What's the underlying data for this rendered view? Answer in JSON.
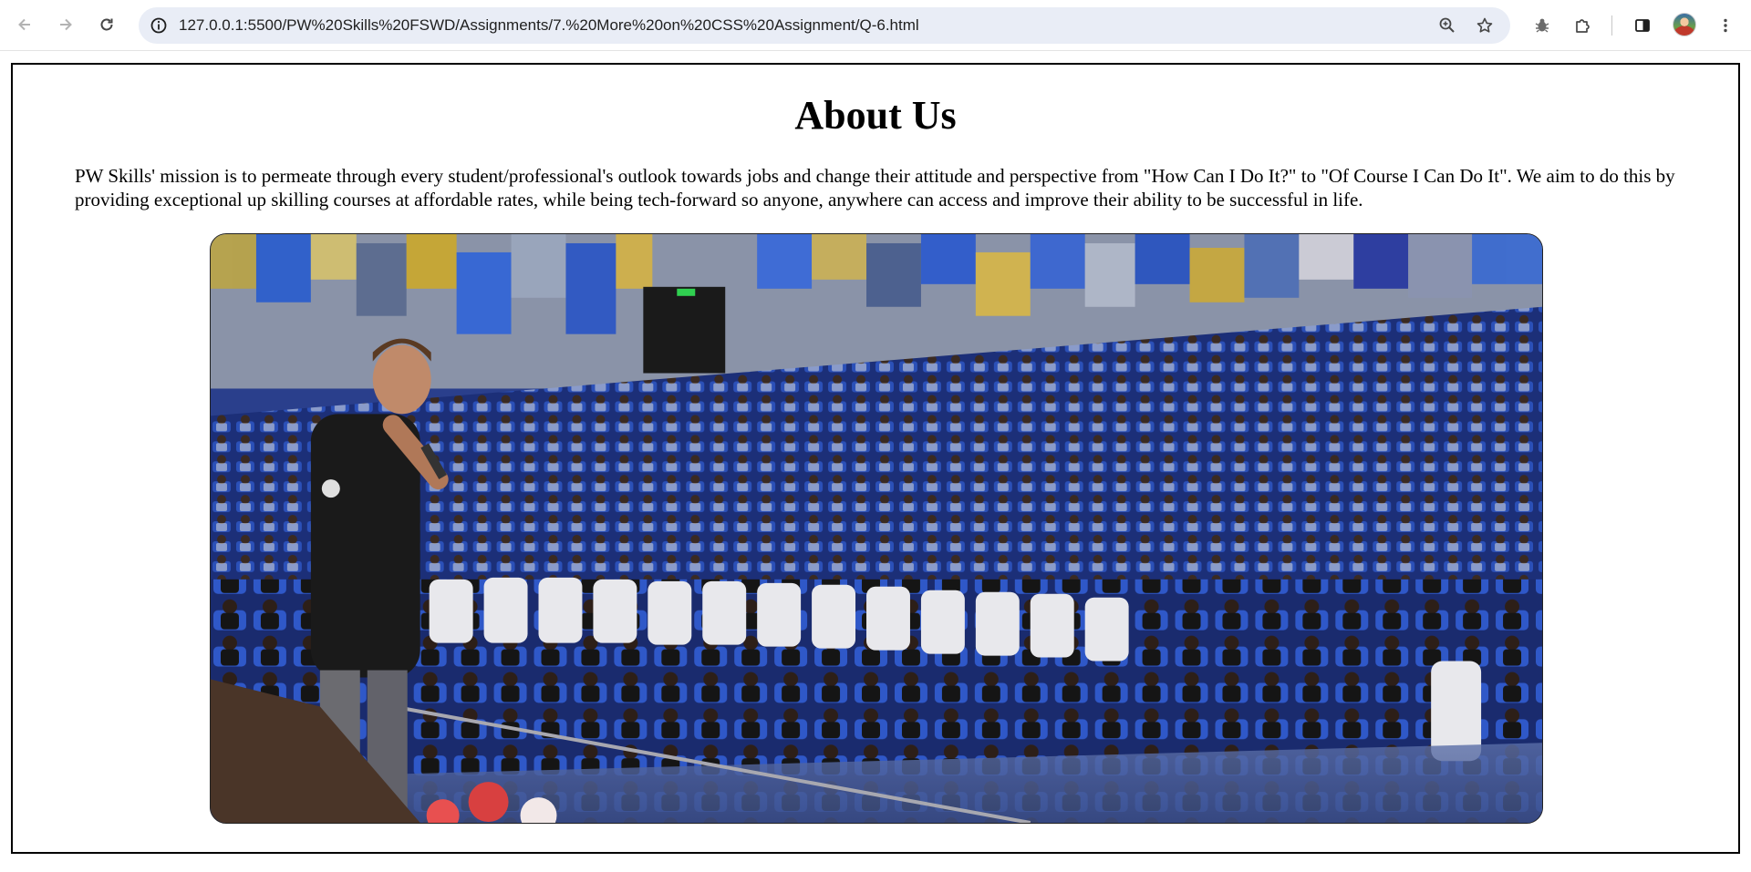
{
  "browser": {
    "url": "127.0.0.1:5500/PW%20Skills%20FSWD/Assignments/7.%20More%20on%20CSS%20Assignment/Q-6.html",
    "icons": {
      "back": "arrow-left-icon",
      "forward": "arrow-right-icon",
      "reload": "reload-icon",
      "site_info": "info-icon",
      "zoom": "zoom-icon",
      "bookmark": "star-icon",
      "extension_bug": "bug-icon",
      "extensions": "puzzle-icon",
      "side_panel": "side-panel-icon",
      "menu": "kebab-menu-icon"
    }
  },
  "page": {
    "title": "About Us",
    "mission": "PW Skills' mission is to permeate through every student/professional's outlook towards jobs and change their attitude and perspective from \"How Can I Do It?\" to \"Of Course I Can Do It\". We aim to do this by providing exceptional up skilling courses at affordable rates, while being tech-forward so anyone, anywhere can access and improve their ability to be successful in life."
  },
  "colors": {
    "omnibox_bg": "#e9edf6",
    "frame_border": "#000000",
    "seat_blue": "#2b50b8"
  }
}
